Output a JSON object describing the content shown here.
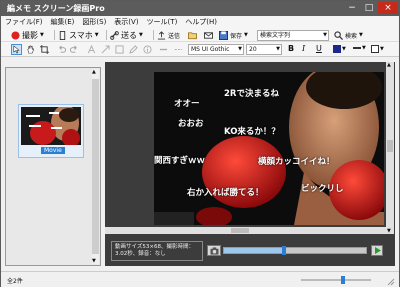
{
  "window": {
    "title": "編メモ スクリーン録画Pro",
    "minimize": "−",
    "maximize": "□",
    "close": "×"
  },
  "menu": [
    "ファイル(F)",
    "編集(E)",
    "図形(S)",
    "表示(V)",
    "ツール(T)",
    "ヘルプ(H)"
  ],
  "toolbar1": {
    "record_label": "撮影",
    "phone_label": "スマホ",
    "send_label": "送る",
    "share_label": "送信",
    "save_label": "保存",
    "search_placeholder": "検索文字列",
    "search_label": "検索"
  },
  "toolbar2": {
    "font_name": "MS UI Gothic",
    "font_size": "20",
    "bold": "B",
    "italic": "I",
    "underline": "U"
  },
  "left": {
    "thumb_label": "Movie"
  },
  "captions": [
    "オオー",
    "2Rで決まるね",
    "おおお",
    "KO来るか！？",
    "関西すぎｗｗ",
    "横顔カッコイイね！",
    "ビックリし",
    "右か入れば勝てる！"
  ],
  "info": {
    "line1": "動画サイズ53×68、撮影時間：",
    "line2": "3.02秒、録音：なし"
  },
  "player": {
    "progress": 0.42
  },
  "status": {
    "text": "全2件"
  },
  "colors": {
    "title_bg": "#5c5c5c",
    "accent": "#2a7fd4",
    "record": "#e02020"
  }
}
